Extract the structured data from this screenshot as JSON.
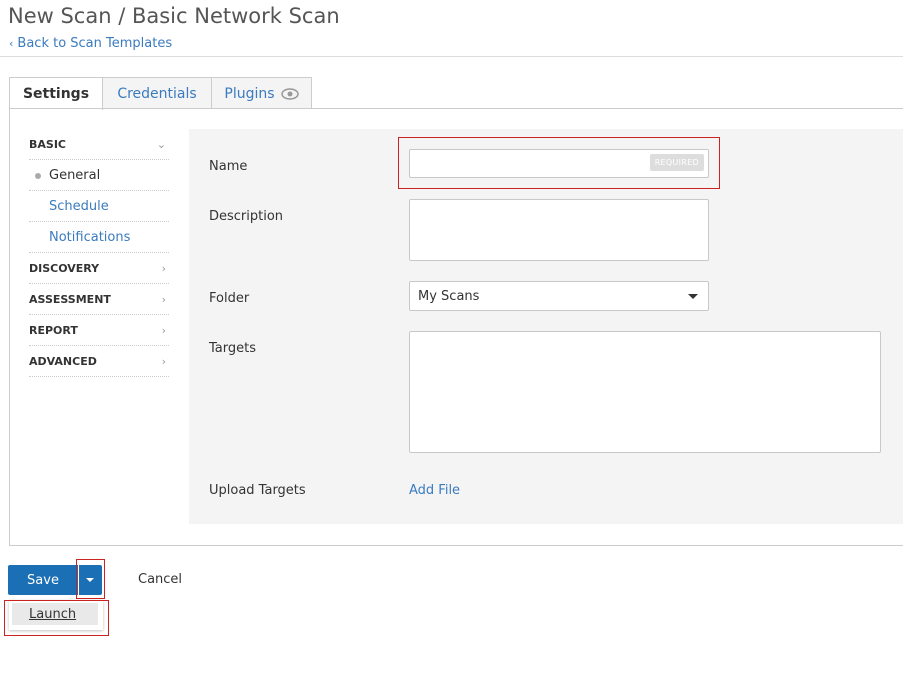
{
  "header": {
    "title": "New Scan / Basic Network Scan",
    "back_link": "Back to Scan Templates"
  },
  "tabs": [
    {
      "label": "Settings",
      "active": true
    },
    {
      "label": "Credentials",
      "active": false
    },
    {
      "label": "Plugins",
      "active": false,
      "icon": "eye-icon"
    }
  ],
  "sidebar": {
    "sections": [
      {
        "label": "BASIC",
        "expanded": true,
        "icon": "chevron-down-icon",
        "items": [
          {
            "label": "General",
            "current": true
          },
          {
            "label": "Schedule",
            "current": false
          },
          {
            "label": "Notifications",
            "current": false
          }
        ]
      },
      {
        "label": "DISCOVERY",
        "expanded": false,
        "icon": "chevron-right-icon"
      },
      {
        "label": "ASSESSMENT",
        "expanded": false,
        "icon": "chevron-right-icon"
      },
      {
        "label": "REPORT",
        "expanded": false,
        "icon": "chevron-right-icon"
      },
      {
        "label": "ADVANCED",
        "expanded": false,
        "icon": "chevron-right-icon"
      }
    ]
  },
  "form": {
    "name": {
      "label": "Name",
      "value": "",
      "badge": "REQUIRED"
    },
    "description": {
      "label": "Description",
      "value": ""
    },
    "folder": {
      "label": "Folder",
      "selected": "My Scans"
    },
    "targets": {
      "label": "Targets",
      "value": ""
    },
    "upload": {
      "label": "Upload Targets",
      "link": "Add File"
    }
  },
  "actions": {
    "save_label": "Save",
    "cancel_label": "Cancel",
    "menu_items": [
      "Launch"
    ]
  },
  "colors": {
    "accent": "#1a6fb5",
    "link": "#3a7bbf",
    "highlight_box": "#cc2222"
  }
}
